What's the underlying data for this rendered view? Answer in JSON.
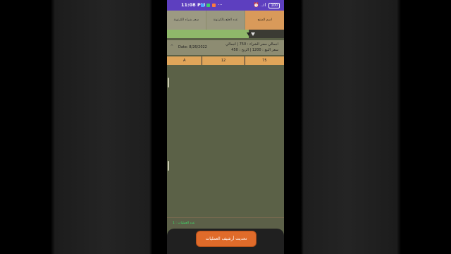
{
  "status_bar": {
    "time": "11:08 PM",
    "extra": "···",
    "signal": "..ıl",
    "battery": "100"
  },
  "header": {
    "col1": "سعر شراء الكرتونة",
    "col2": "عدد العلع بالكرتونة",
    "col3": "اسم المنتج"
  },
  "summary": {
    "date": "Date: 8/26/2022",
    "line1": "اجمالي سعر الشراء : 750 | اجمالي",
    "line2": "سعر البيع : 1200 | الربح : 450"
  },
  "row": {
    "name": "A",
    "count": "12",
    "price": "75"
  },
  "footer": {
    "count_label": "عدد العمليات : 1"
  },
  "update_button": "تحديث أرشيف العمليات",
  "colors": {
    "status_bar": "#5d3fbf",
    "app_bg": "#5b6147",
    "accent_orange": "#e06b2a",
    "filter_green": "#8fb86a",
    "count_green": "#3fdc6a"
  }
}
